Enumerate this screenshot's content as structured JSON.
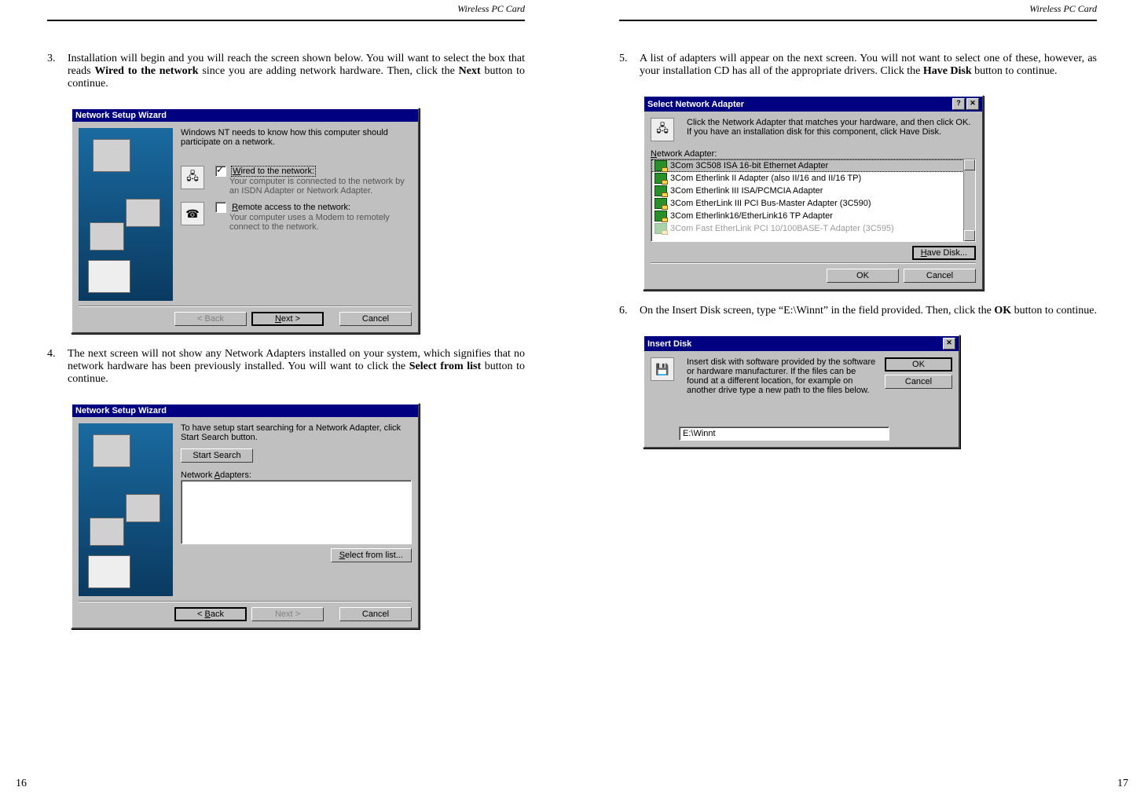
{
  "header": {
    "title": "Wireless  PC  Card"
  },
  "pageNumbers": {
    "left": "16",
    "right": "17"
  },
  "left": {
    "step3": {
      "num": "3.",
      "t1": "Installation will begin and you will reach the screen shown below. You will want to select the box that reads ",
      "b1": "Wired to the network",
      "t2": " since you are adding network hardware. Then, click the ",
      "b2": "Next",
      "t3": " button to continue."
    },
    "wiz1": {
      "title": "Network Setup Wizard",
      "intro": "Windows NT needs to know how this computer should participate on a network.",
      "wiredLabel": "Wired to the network:",
      "wiredDesc": "Your computer is connected to the network by an ISDN Adapter or Network Adapter.",
      "remoteLabel": "Remote access to the network:",
      "remoteDesc": "Your computer uses a Modem to remotely connect to the network.",
      "back": "< Back",
      "next": "Next >",
      "cancel": "Cancel"
    },
    "step4": {
      "num": "4.",
      "t1": "The next screen will not show any Network Adapters installed on your system, which signifies that no network hardware has been previously installed. You will want to click the ",
      "b1": "Select from list",
      "t2": " button to continue."
    },
    "wiz2": {
      "title": "Network Setup Wizard",
      "intro": "To have setup start searching for a Network Adapter, click Start Search button.",
      "startSearch": "Start Search",
      "adaptersLabel": "Network Adapters:",
      "selectFromList": "Select from list...",
      "back": "< Back",
      "next": "Next >",
      "cancel": "Cancel"
    }
  },
  "right": {
    "step5": {
      "num": "5.",
      "t1": "A list of adapters will appear on the next screen. You will not want to select one of these, however, as your installation CD has all of the appropriate drivers. Click the ",
      "b1": "Have Disk",
      "t2": " button to continue."
    },
    "dlgAdapter": {
      "title": "Select Network Adapter",
      "help": "?",
      "close": "✕",
      "instr": "Click the Network Adapter that matches your hardware, and then click OK.  If you have an installation disk for this component, click Have Disk.",
      "listLabel": "Network Adapter:",
      "items": [
        "3Com 3C508 ISA 16-bit Ethernet Adapter",
        "3Com Etherlink II Adapter (also II/16 and II/16 TP)",
        "3Com Etherlink III ISA/PCMCIA Adapter",
        "3Com EtherLink III PCI Bus-Master Adapter (3C590)",
        "3Com Etherlink16/EtherLink16 TP Adapter",
        "3Com Fast EtherLink PCI 10/100BASE-T Adapter (3C595)"
      ],
      "haveDisk": "Have Disk...",
      "ok": "OK",
      "cancel": "Cancel"
    },
    "step6": {
      "num": "6.",
      "t1": "On the Insert Disk screen, type “E:\\Winnt” in the field provided. Then, click the ",
      "b1": "OK",
      "t2": " button to continue."
    },
    "dlgInsert": {
      "title": "Insert Disk",
      "close": "✕",
      "instr": "Insert disk with software provided by the software or hardware manufacturer.  If the files can be found at a different location, for example on another drive type a new path to the files below.",
      "path": "E:\\Winnt",
      "ok": "OK",
      "cancel": "Cancel"
    }
  }
}
